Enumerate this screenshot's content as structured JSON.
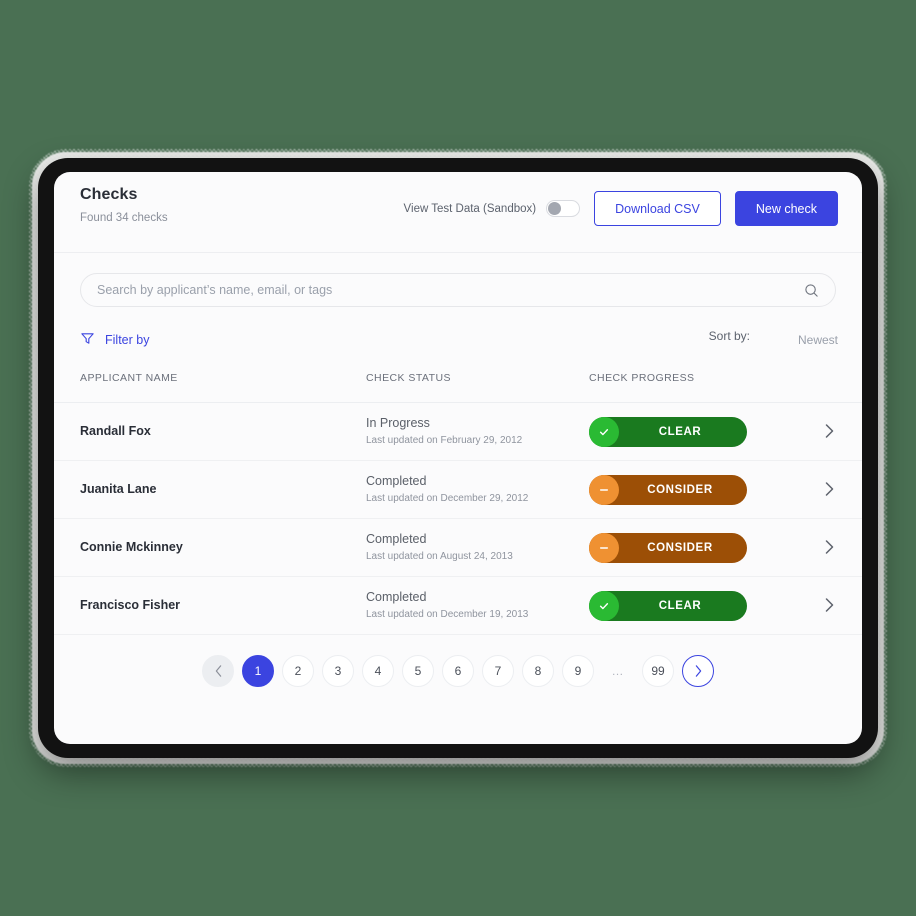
{
  "header": {
    "title": "Checks",
    "subtitle": "Found 34 checks",
    "toggle_label": "View Test Data (Sandbox)",
    "toggle_state": "off",
    "download_label": "Download CSV",
    "new_check_label": "New check"
  },
  "search": {
    "placeholder": "Search by applicant’s name, email, or tags",
    "value": ""
  },
  "filter": {
    "filter_label": "Filter by",
    "sort_label": "Sort by:",
    "sort_value": "Newest"
  },
  "table": {
    "columns": [
      "APPLICANT NAME",
      "CHECK STATUS",
      "CHECK PROGRESS"
    ],
    "rows": [
      {
        "name": "Randall Fox",
        "status": "In Progress",
        "updated": "Last updated on February 29, 2012",
        "progress": "CLEAR",
        "progress_kind": "clear"
      },
      {
        "name": "Juanita Lane",
        "status": "Completed",
        "updated": "Last updated on December 29, 2012",
        "progress": "CONSIDER",
        "progress_kind": "consider"
      },
      {
        "name": "Connie Mckinney",
        "status": "Completed",
        "updated": "Last updated on August 24, 2013",
        "progress": "CONSIDER",
        "progress_kind": "consider"
      },
      {
        "name": "Francisco Fisher",
        "status": "Completed",
        "updated": "Last updated on December 19, 2013",
        "progress": "CLEAR",
        "progress_kind": "clear"
      }
    ]
  },
  "pagination": {
    "prev": "‹",
    "next": "›",
    "pages": [
      "1",
      "2",
      "3",
      "4",
      "5",
      "6",
      "7",
      "8",
      "9",
      "…",
      "99"
    ],
    "active": "1"
  },
  "colors": {
    "accent": "#3b44e0",
    "clear_bar": "#1a7a1f",
    "clear_dot": "#2aba33",
    "consider_bar": "#9c4f06",
    "consider_dot": "#ef9132",
    "background": "#4a7053"
  }
}
